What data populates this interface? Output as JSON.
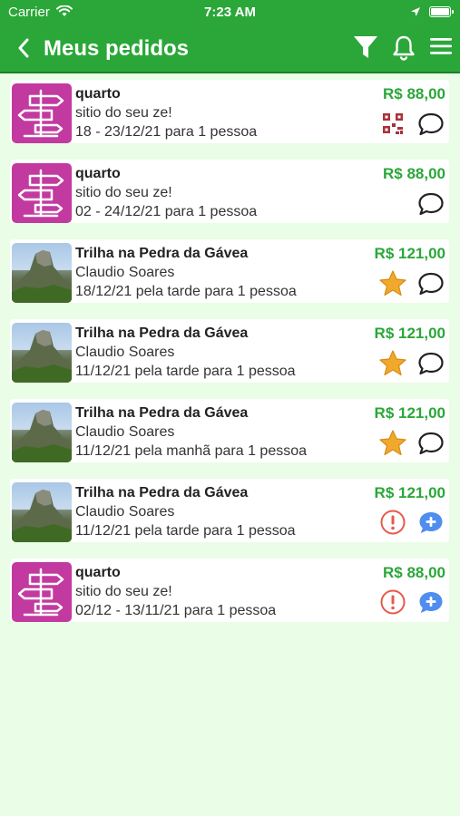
{
  "status_bar": {
    "carrier": "Carrier",
    "time": "7:23 AM"
  },
  "header": {
    "title": "Meus pedidos"
  },
  "icons": {
    "back": "chevron-left-icon",
    "filter": "filter-icon",
    "notifications": "bell-icon",
    "menu": "hamburger-menu-icon"
  },
  "colors": {
    "primary": "#2aa738",
    "background": "#eafde6",
    "price": "#2aa738",
    "star": "#f0a92c",
    "alert": "#e8594a",
    "chat_add": "#4f8ef0",
    "thumb_sign": "#c23aa0"
  },
  "orders": [
    {
      "thumb": "signpost",
      "title": "quarto",
      "subtitle": "sitio do seu ze!",
      "details": "18 - 23/12/21 para 1 pessoa",
      "price": "R$ 88,00",
      "actions": [
        "qr-code-icon",
        "chat-icon"
      ]
    },
    {
      "thumb": "signpost",
      "title": "quarto",
      "subtitle": "sitio do seu ze!",
      "details": "02 - 24/12/21 para 1 pessoa",
      "price": "R$ 88,00",
      "actions": [
        "chat-icon"
      ]
    },
    {
      "thumb": "mountain",
      "title": "Trilha na Pedra da Gávea",
      "subtitle": "Claudio Soares",
      "details": "18/12/21 pela tarde para 1 pessoa",
      "price": "R$ 121,00",
      "actions": [
        "star-icon",
        "chat-icon"
      ]
    },
    {
      "thumb": "mountain",
      "title": "Trilha na Pedra da Gávea",
      "subtitle": "Claudio Soares",
      "details": "11/12/21 pela tarde para 1 pessoa",
      "price": "R$ 121,00",
      "actions": [
        "star-icon",
        "chat-icon"
      ]
    },
    {
      "thumb": "mountain",
      "title": "Trilha na Pedra da Gávea",
      "subtitle": "Claudio Soares",
      "details": "11/12/21 pela manhã para 1 pessoa",
      "price": "R$ 121,00",
      "actions": [
        "star-icon",
        "chat-icon"
      ]
    },
    {
      "thumb": "mountain",
      "title": "Trilha na Pedra da Gávea",
      "subtitle": "Claudio Soares",
      "details": "11/12/21 pela tarde para 1 pessoa",
      "price": "R$ 121,00",
      "actions": [
        "alert-icon",
        "chat-add-icon"
      ]
    },
    {
      "thumb": "signpost",
      "title": "quarto",
      "subtitle": "sitio do seu ze!",
      "details": "02/12 - 13/11/21 para 1 pessoa",
      "price": "R$ 88,00",
      "actions": [
        "alert-icon",
        "chat-add-icon"
      ]
    }
  ]
}
